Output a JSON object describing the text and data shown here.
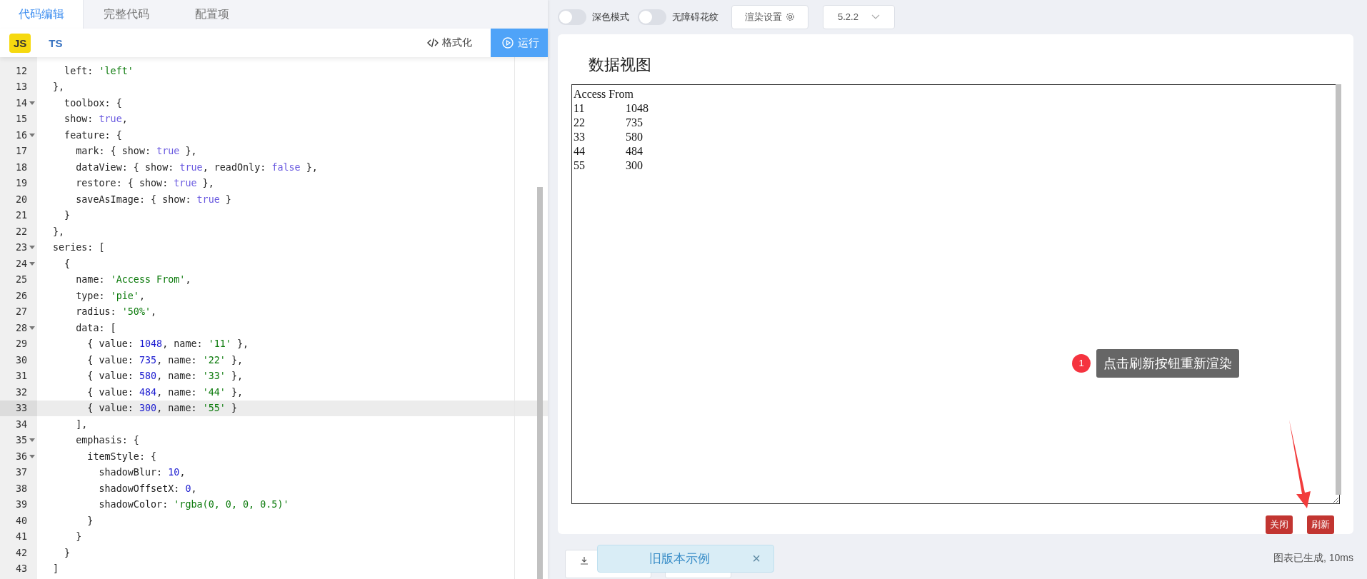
{
  "editor_tabs": [
    {
      "label": "代码编辑",
      "selected": true
    },
    {
      "label": "完整代码",
      "selected": false
    },
    {
      "label": "配置项",
      "selected": false
    }
  ],
  "language_tabs": [
    {
      "label": "JS",
      "selected": true
    },
    {
      "label": "TS",
      "selected": false
    }
  ],
  "format_button": "格式化",
  "run_button": "运行",
  "code_lines": [
    {
      "number": "12",
      "foldable": false,
      "current": false,
      "tokens": [
        {
          "kind": "plain",
          "text": "  left: "
        },
        {
          "kind": "string",
          "text": "'left'"
        }
      ]
    },
    {
      "number": "13",
      "foldable": false,
      "current": false,
      "tokens": [
        {
          "kind": "plain",
          "text": "},"
        }
      ]
    },
    {
      "number": "14",
      "foldable": true,
      "current": false,
      "tokens": [
        {
          "kind": "plain",
          "text": "  toolbox: {"
        }
      ]
    },
    {
      "number": "15",
      "foldable": false,
      "current": false,
      "tokens": [
        {
          "kind": "plain",
          "text": "  show: "
        },
        {
          "kind": "keyword",
          "text": "true"
        },
        {
          "kind": "plain",
          "text": ","
        }
      ]
    },
    {
      "number": "16",
      "foldable": true,
      "current": false,
      "tokens": [
        {
          "kind": "plain",
          "text": "  feature: {"
        }
      ]
    },
    {
      "number": "17",
      "foldable": false,
      "current": false,
      "tokens": [
        {
          "kind": "plain",
          "text": "    mark: { show: "
        },
        {
          "kind": "keyword",
          "text": "true"
        },
        {
          "kind": "plain",
          "text": " },"
        }
      ]
    },
    {
      "number": "18",
      "foldable": false,
      "current": false,
      "tokens": [
        {
          "kind": "plain",
          "text": "    dataView: { show: "
        },
        {
          "kind": "keyword",
          "text": "true"
        },
        {
          "kind": "plain",
          "text": ", readOnly: "
        },
        {
          "kind": "keyword",
          "text": "false"
        },
        {
          "kind": "plain",
          "text": " },"
        }
      ]
    },
    {
      "number": "19",
      "foldable": false,
      "current": false,
      "tokens": [
        {
          "kind": "plain",
          "text": "    restore: { show: "
        },
        {
          "kind": "keyword",
          "text": "true"
        },
        {
          "kind": "plain",
          "text": " },"
        }
      ]
    },
    {
      "number": "20",
      "foldable": false,
      "current": false,
      "tokens": [
        {
          "kind": "plain",
          "text": "    saveAsImage: { show: "
        },
        {
          "kind": "keyword",
          "text": "true"
        },
        {
          "kind": "plain",
          "text": " }"
        }
      ]
    },
    {
      "number": "21",
      "foldable": false,
      "current": false,
      "tokens": [
        {
          "kind": "plain",
          "text": "  }"
        }
      ]
    },
    {
      "number": "22",
      "foldable": false,
      "current": false,
      "tokens": [
        {
          "kind": "plain",
          "text": "},"
        }
      ]
    },
    {
      "number": "23",
      "foldable": true,
      "current": false,
      "tokens": [
        {
          "kind": "plain",
          "text": "series: ["
        }
      ]
    },
    {
      "number": "24",
      "foldable": true,
      "current": false,
      "tokens": [
        {
          "kind": "plain",
          "text": "  {"
        }
      ]
    },
    {
      "number": "25",
      "foldable": false,
      "current": false,
      "tokens": [
        {
          "kind": "plain",
          "text": "    name: "
        },
        {
          "kind": "string",
          "text": "'Access From'"
        },
        {
          "kind": "plain",
          "text": ","
        }
      ]
    },
    {
      "number": "26",
      "foldable": false,
      "current": false,
      "tokens": [
        {
          "kind": "plain",
          "text": "    type: "
        },
        {
          "kind": "string",
          "text": "'pie'"
        },
        {
          "kind": "plain",
          "text": ","
        }
      ]
    },
    {
      "number": "27",
      "foldable": false,
      "current": false,
      "tokens": [
        {
          "kind": "plain",
          "text": "    radius: "
        },
        {
          "kind": "string",
          "text": "'50%'"
        },
        {
          "kind": "plain",
          "text": ","
        }
      ]
    },
    {
      "number": "28",
      "foldable": true,
      "current": false,
      "tokens": [
        {
          "kind": "plain",
          "text": "    data: ["
        }
      ]
    },
    {
      "number": "29",
      "foldable": false,
      "current": false,
      "tokens": [
        {
          "kind": "plain",
          "text": "      { value: "
        },
        {
          "kind": "number",
          "text": "1048"
        },
        {
          "kind": "plain",
          "text": ", name: "
        },
        {
          "kind": "string",
          "text": "'11'"
        },
        {
          "kind": "plain",
          "text": " },"
        }
      ]
    },
    {
      "number": "30",
      "foldable": false,
      "current": false,
      "tokens": [
        {
          "kind": "plain",
          "text": "      { value: "
        },
        {
          "kind": "number",
          "text": "735"
        },
        {
          "kind": "plain",
          "text": ", name: "
        },
        {
          "kind": "string",
          "text": "'22'"
        },
        {
          "kind": "plain",
          "text": " },"
        }
      ]
    },
    {
      "number": "31",
      "foldable": false,
      "current": false,
      "tokens": [
        {
          "kind": "plain",
          "text": "      { value: "
        },
        {
          "kind": "number",
          "text": "580"
        },
        {
          "kind": "plain",
          "text": ", name: "
        },
        {
          "kind": "string",
          "text": "'33'"
        },
        {
          "kind": "plain",
          "text": " },"
        }
      ]
    },
    {
      "number": "32",
      "foldable": false,
      "current": false,
      "tokens": [
        {
          "kind": "plain",
          "text": "      { value: "
        },
        {
          "kind": "number",
          "text": "484"
        },
        {
          "kind": "plain",
          "text": ", name: "
        },
        {
          "kind": "string",
          "text": "'44'"
        },
        {
          "kind": "plain",
          "text": " },"
        }
      ]
    },
    {
      "number": "33",
      "foldable": false,
      "current": true,
      "tokens": [
        {
          "kind": "plain",
          "text": "      { value: "
        },
        {
          "kind": "number",
          "text": "300"
        },
        {
          "kind": "plain",
          "text": ", name: "
        },
        {
          "kind": "string",
          "text": "'55'"
        },
        {
          "kind": "plain",
          "text": " }"
        }
      ]
    },
    {
      "number": "34",
      "foldable": false,
      "current": false,
      "tokens": [
        {
          "kind": "plain",
          "text": "    ],"
        }
      ]
    },
    {
      "number": "35",
      "foldable": true,
      "current": false,
      "tokens": [
        {
          "kind": "plain",
          "text": "    emphasis: {"
        }
      ]
    },
    {
      "number": "36",
      "foldable": true,
      "current": false,
      "tokens": [
        {
          "kind": "plain",
          "text": "      itemStyle: {"
        }
      ]
    },
    {
      "number": "37",
      "foldable": false,
      "current": false,
      "tokens": [
        {
          "kind": "plain",
          "text": "        shadowBlur: "
        },
        {
          "kind": "number",
          "text": "10"
        },
        {
          "kind": "plain",
          "text": ","
        }
      ]
    },
    {
      "number": "38",
      "foldable": false,
      "current": false,
      "tokens": [
        {
          "kind": "plain",
          "text": "        shadowOffsetX: "
        },
        {
          "kind": "number",
          "text": "0"
        },
        {
          "kind": "plain",
          "text": ","
        }
      ]
    },
    {
      "number": "39",
      "foldable": false,
      "current": false,
      "tokens": [
        {
          "kind": "plain",
          "text": "        shadowColor: "
        },
        {
          "kind": "string",
          "text": "'rgba(0, 0, 0, 0.5)'"
        }
      ]
    },
    {
      "number": "40",
      "foldable": false,
      "current": false,
      "tokens": [
        {
          "kind": "plain",
          "text": "      }"
        }
      ]
    },
    {
      "number": "41",
      "foldable": false,
      "current": false,
      "tokens": [
        {
          "kind": "plain",
          "text": "    }"
        }
      ]
    },
    {
      "number": "42",
      "foldable": false,
      "current": false,
      "tokens": [
        {
          "kind": "plain",
          "text": "  }"
        }
      ]
    },
    {
      "number": "43",
      "foldable": false,
      "current": false,
      "tokens": [
        {
          "kind": "plain",
          "text": "]"
        }
      ]
    }
  ],
  "toggles": [
    {
      "label": "深色模式",
      "on": false
    },
    {
      "label": "无障碍花纹",
      "on": false
    }
  ],
  "render_settings_button": "渲染设置",
  "version_select": "5.2.2",
  "data_view": {
    "title": "数据视图",
    "content_lines": [
      "Access From",
      "11\t1048",
      "22\t735",
      "33\t580",
      "44\t484",
      "55\t300"
    ],
    "buttons": [
      "关闭",
      "刷新"
    ]
  },
  "annotation": {
    "step": "1",
    "text": "点击刷新按钮重新渲染"
  },
  "toast": {
    "text": "旧版本示例",
    "close": "×"
  },
  "status": "图表已生成, 10ms"
}
